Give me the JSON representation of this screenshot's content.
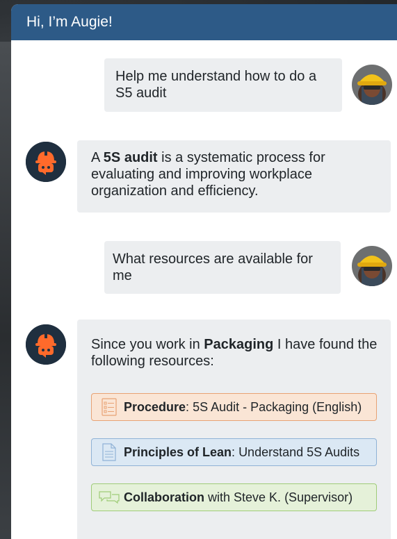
{
  "header": {
    "title": "Hi, I’m Augie!"
  },
  "messages": [
    {
      "from": "user",
      "text": "Help me understand how to do a S5 audit"
    },
    {
      "from": "bot",
      "bold": "5S audit",
      "pre": "A ",
      "post": " is a systematic process for evaluating and improving workplace organization and efficiency."
    },
    {
      "from": "user",
      "text": "What resources are available for me"
    },
    {
      "from": "bot",
      "pre": "Since you work in ",
      "bold": "Packaging",
      "post": " I have found the following resources:"
    }
  ],
  "resources": [
    {
      "icon": "checklist-icon",
      "title": "Procedure",
      "sep": ": ",
      "desc": "5S Audit - Packaging (English)",
      "color": "#fae5d5"
    },
    {
      "icon": "document-icon",
      "title": "Principles of Lean",
      "sep": ": ",
      "desc": "Understand 5S Audits",
      "color": "#dbe8f4"
    },
    {
      "icon": "chat-bubbles-icon",
      "title": "Collaboration",
      "sep": " ",
      "desc": "with Steve K. (Supervisor)",
      "color": "#e5f1d9"
    }
  ],
  "colors": {
    "header": "#2d5a87",
    "bubble": "#eceef0",
    "bot_avatar": "#1f2f3f",
    "bot_accent": "#ff6a2b",
    "helmet": "#f2c21a"
  }
}
